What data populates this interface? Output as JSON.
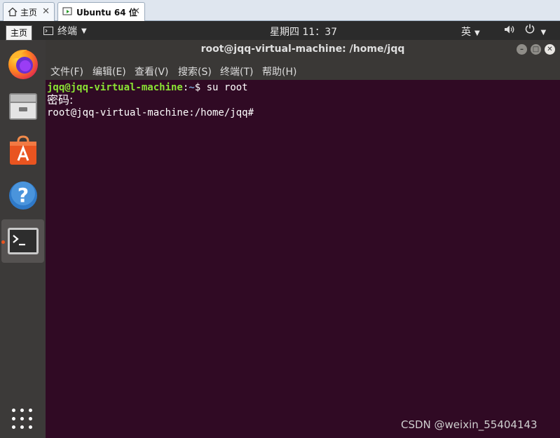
{
  "vm_tabs": [
    {
      "label": "主页"
    },
    {
      "label": "Ubuntu 64 位"
    }
  ],
  "tooltip": "主页",
  "topbar": {
    "app_label": "终端",
    "clock": "星期四 11：37",
    "input_method": "英"
  },
  "terminal": {
    "title": "root@jqq-virtual-machine: /home/jqq",
    "menu": [
      "文件(F)",
      "编辑(E)",
      "查看(V)",
      "搜索(S)",
      "终端(T)",
      "帮助(H)"
    ],
    "lines": {
      "l1_user": "jqq@jqq-virtual-machine",
      "l1_colon": ":",
      "l1_path": "~",
      "l1_cmd": "$ su root",
      "l2": "密码:",
      "l3": "root@jqq-virtual-machine:/home/jqq#"
    }
  },
  "dock": [
    "firefox-icon",
    "files-icon",
    "software-icon",
    "help-icon",
    "terminal-icon",
    "show-apps-icon"
  ],
  "colors": {
    "terminal_bg": "#300a24",
    "prompt_user": "#8ae234",
    "prompt_path": "#729fcf",
    "accent": "#e95420"
  },
  "watermark": "CSDN @weixin_55404143"
}
